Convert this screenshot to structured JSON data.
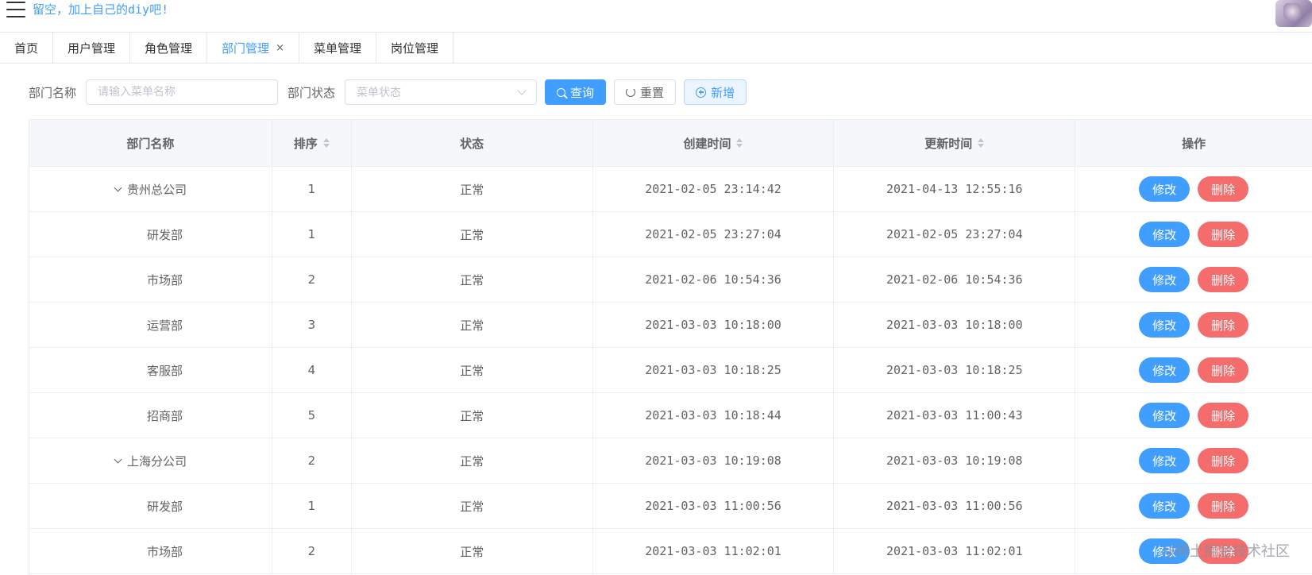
{
  "header": {
    "slogan": "留空，加上自己的diy吧!"
  },
  "tabs": [
    {
      "label": "首页"
    },
    {
      "label": "用户管理"
    },
    {
      "label": "角色管理"
    },
    {
      "label": "部门管理",
      "close": "×"
    },
    {
      "label": "菜单管理"
    },
    {
      "label": "岗位管理"
    }
  ],
  "search": {
    "name_label": "部门名称",
    "name_placeholder": "请输入菜单名称",
    "status_label": "部门状态",
    "status_placeholder": "菜单状态",
    "query_label": "查询",
    "reset_label": "重置",
    "add_label": "新增"
  },
  "table": {
    "headers": [
      "部门名称",
      "排序",
      "状态",
      "创建时间",
      "更新时间",
      "操作"
    ],
    "edit_label": "修改",
    "delete_label": "删除",
    "rows": [
      {
        "name": "贵州总公司",
        "order": "1",
        "status": "正常",
        "created": "2021-02-05 23:14:42",
        "updated": "2021-04-13 12:55:16"
      },
      {
        "name": "研发部",
        "order": "1",
        "status": "正常",
        "created": "2021-02-05 23:27:04",
        "updated": "2021-02-05 23:27:04"
      },
      {
        "name": "市场部",
        "order": "2",
        "status": "正常",
        "created": "2021-02-06 10:54:36",
        "updated": "2021-02-06 10:54:36"
      },
      {
        "name": "运营部",
        "order": "3",
        "status": "正常",
        "created": "2021-03-03 10:18:00",
        "updated": "2021-03-03 10:18:00"
      },
      {
        "name": "客服部",
        "order": "4",
        "status": "正常",
        "created": "2021-03-03 10:18:25",
        "updated": "2021-03-03 10:18:25"
      },
      {
        "name": "招商部",
        "order": "5",
        "status": "正常",
        "created": "2021-03-03 10:18:44",
        "updated": "2021-03-03 11:00:43"
      },
      {
        "name": "上海分公司",
        "order": "2",
        "status": "正常",
        "created": "2021-03-03 10:19:08",
        "updated": "2021-03-03 10:19:08"
      },
      {
        "name": "研发部",
        "order": "1",
        "status": "正常",
        "created": "2021-03-03 11:00:56",
        "updated": "2021-03-03 11:00:56"
      },
      {
        "name": "市场部",
        "order": "2",
        "status": "正常",
        "created": "2021-03-03 11:02:01",
        "updated": "2021-03-03 11:02:01"
      }
    ]
  },
  "watermark": "@稀土掘金技术社区",
  "colors": {
    "primary": "#409eff",
    "danger": "#f56c6c",
    "header_bg": "#f5f7fa"
  }
}
